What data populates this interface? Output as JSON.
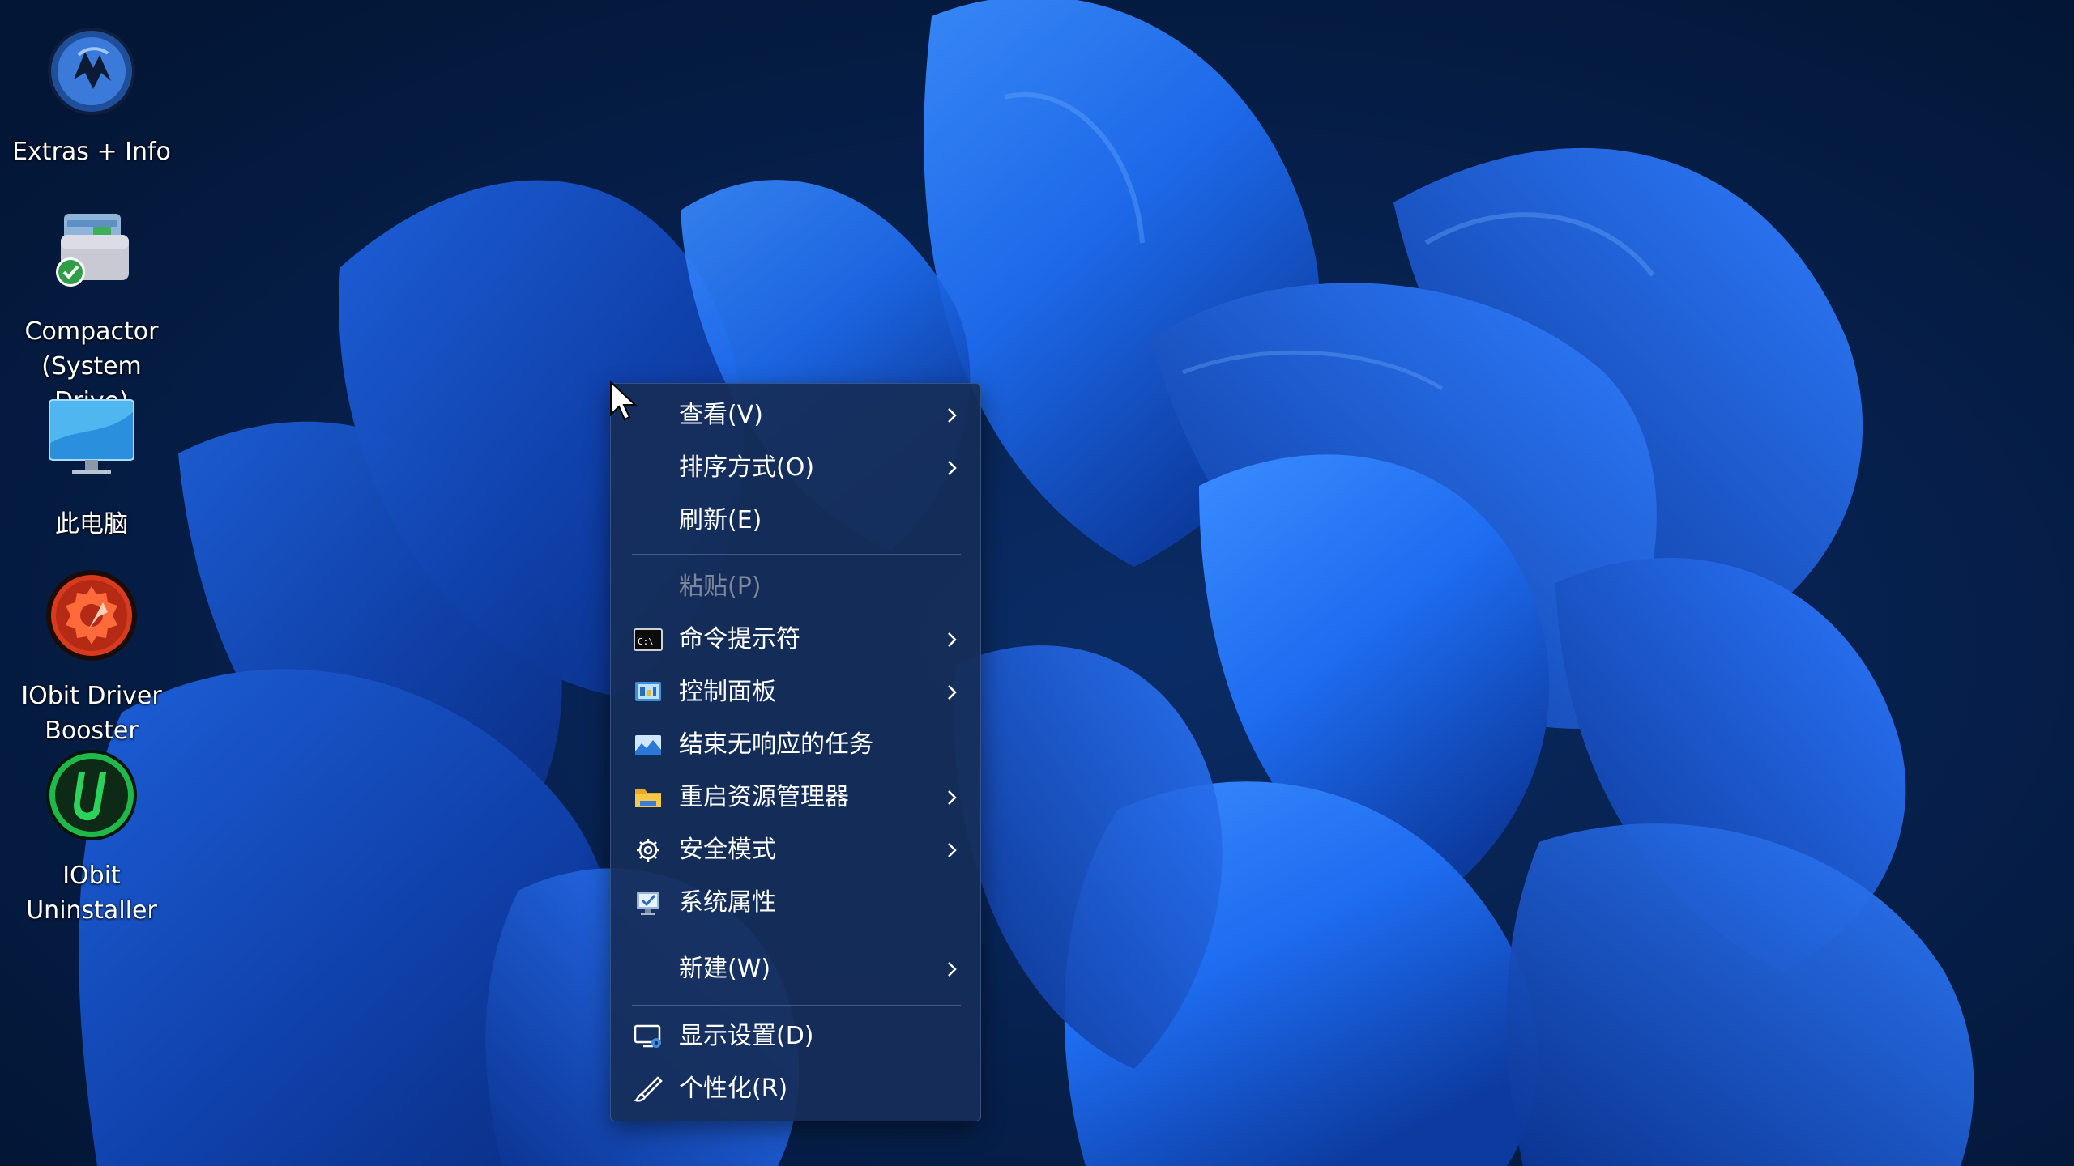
{
  "desktop": {
    "icons": [
      {
        "label": "Extras + Info",
        "icon": "extras-info-icon"
      },
      {
        "label": "Compactor\n(System Drive)",
        "icon": "compactor-icon"
      },
      {
        "label": "此电脑",
        "icon": "this-pc-icon"
      },
      {
        "label": "IObit Driver\nBooster",
        "icon": "driver-booster-icon"
      },
      {
        "label": "IObit\nUninstaller",
        "icon": "uninstaller-icon"
      }
    ]
  },
  "context_menu": {
    "items": [
      {
        "label": "查看(V)",
        "has_submenu": true,
        "enabled": true,
        "icon": ""
      },
      {
        "label": "排序方式(O)",
        "has_submenu": true,
        "enabled": true,
        "icon": ""
      },
      {
        "label": "刷新(E)",
        "has_submenu": false,
        "enabled": true,
        "icon": ""
      },
      {
        "label": "粘贴(P)",
        "has_submenu": false,
        "enabled": false,
        "icon": ""
      },
      {
        "label": "命令提示符",
        "has_submenu": true,
        "enabled": true,
        "icon": "command-prompt-icon"
      },
      {
        "label": "控制面板",
        "has_submenu": true,
        "enabled": true,
        "icon": "control-panel-icon"
      },
      {
        "label": "结束无响应的任务",
        "has_submenu": false,
        "enabled": true,
        "icon": "end-task-icon"
      },
      {
        "label": "重启资源管理器",
        "has_submenu": true,
        "enabled": true,
        "icon": "folder-icon"
      },
      {
        "label": "安全模式",
        "has_submenu": true,
        "enabled": true,
        "icon": "gear-icon"
      },
      {
        "label": "系统属性",
        "has_submenu": false,
        "enabled": true,
        "icon": "system-properties-icon"
      },
      {
        "label": "新建(W)",
        "has_submenu": true,
        "enabled": true,
        "icon": ""
      },
      {
        "label": "显示设置(D)",
        "has_submenu": false,
        "enabled": true,
        "icon": "display-settings-icon"
      },
      {
        "label": "个性化(R)",
        "has_submenu": false,
        "enabled": true,
        "icon": "brush-icon"
      }
    ]
  },
  "colors": {
    "menu_background": "#162d58",
    "menu_text": "#ffffff",
    "menu_disabled_text": "#7d879a",
    "wallpaper_dark": "#04193a",
    "wallpaper_blue": "#1e6cf0"
  }
}
